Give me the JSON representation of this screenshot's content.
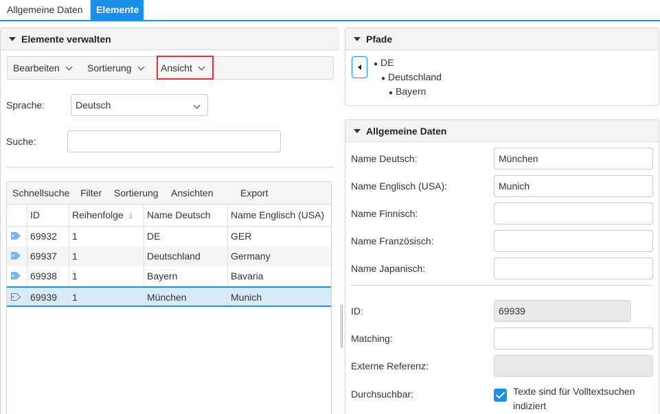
{
  "tabs": [
    {
      "label": "Allgemeine Daten",
      "active": false
    },
    {
      "label": "Elemente",
      "active": true
    }
  ],
  "left_panel": {
    "title": "Elemente verwalten",
    "toolbar": [
      "Bearbeiten",
      "Sortierung",
      "Ansicht"
    ],
    "sprache_label": "Sprache:",
    "sprache_value": "Deutsch",
    "suche_label": "Suche:",
    "suche_value": "",
    "grid_toolbar": [
      "Schnellsuche",
      "Filter",
      "Sortierung",
      "Ansichten",
      "Export"
    ],
    "columns": [
      "ID",
      "Reihenfolge",
      "Name Deutsch",
      "Name Englisch (USA)"
    ],
    "rows": [
      {
        "id": "69932",
        "order": "1",
        "name_de": "DE",
        "name_en": "GER",
        "selected": false
      },
      {
        "id": "69937",
        "order": "1",
        "name_de": "Deutschland",
        "name_en": "Germany",
        "selected": false
      },
      {
        "id": "69938",
        "order": "1",
        "name_de": "Bayern",
        "name_en": "Bavaria",
        "selected": false
      },
      {
        "id": "69939",
        "order": "1",
        "name_de": "München",
        "name_en": "Munich",
        "selected": true
      }
    ]
  },
  "pfade_panel": {
    "title": "Pfade",
    "tree": [
      "DE",
      "Deutschland",
      "Bayern"
    ]
  },
  "data_panel": {
    "title": "Allgemeine Daten",
    "fields": [
      {
        "label": "Name Deutsch:",
        "value": "München"
      },
      {
        "label": "Name Englisch (USA):",
        "value": "Munich"
      },
      {
        "label": "Name Finnisch:",
        "value": ""
      },
      {
        "label": "Name Französisch:",
        "value": ""
      },
      {
        "label": "Name Japanisch:",
        "value": ""
      }
    ],
    "id_label": "ID:",
    "id_value": "69939",
    "matching_label": "Matching:",
    "matching_value": "",
    "extref_label": "Externe Referenz:",
    "extref_value": "",
    "durchsuchbar_label": "Durchsuchbar:",
    "durchsuchbar_checked": true,
    "durchsuchbar_text_1": "Texte sind für Volltextsuchen",
    "durchsuchbar_text_2": "indiziert"
  },
  "colors": {
    "accent": "#1a8ee8",
    "highlight": "#e0303a",
    "tag": "#7fb4e6"
  }
}
